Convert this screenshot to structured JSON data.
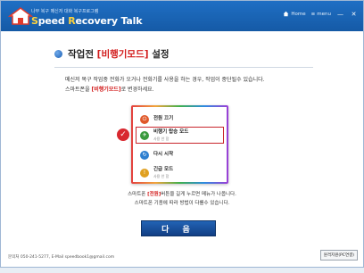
{
  "titlebar": {
    "subtitle": "나무 복구 메신저 대화 복구프로그램",
    "name_first": "S",
    "name_rest1": "peed ",
    "name_o": "R",
    "name_rest2": "ecovery Talk",
    "home_label": "Home",
    "menu_label": "menu",
    "minimize_glyph": "—",
    "close_glyph": "✕"
  },
  "heading": {
    "prefix": "작업전 ",
    "highlight": "[비행기모드]",
    "suffix": " 설정"
  },
  "description": {
    "line1": "메신저 복구 작업중 전화가 오거나 전화기를 사용을 하는 경우, 작업이 중단될수 있습니다.",
    "line2_prefix": "스마트폰을 ",
    "line2_highlight": "[비행기모드]",
    "line2_suffix": "로 변경하세요."
  },
  "phone_menu": [
    {
      "label": "전원 끄기",
      "sub": "",
      "icon": "power-icon",
      "color": "#e0582a",
      "selected": false
    },
    {
      "label": "비행기 탑승 모드",
      "sub": "사용 안 함",
      "icon": "airplane-icon",
      "color": "#3a9a3e",
      "selected": true
    },
    {
      "label": "다시 시작",
      "sub": "",
      "icon": "restart-icon",
      "color": "#2d7fd0",
      "selected": false
    },
    {
      "label": "긴급 모드",
      "sub": "사용 안 함",
      "icon": "emergency-icon",
      "color": "#e0a020",
      "selected": false
    }
  ],
  "info": {
    "line1_prefix": "스마트폰 ",
    "line1_highlight": "[전원]",
    "line1_suffix": "버튼을 길게 누르면 메뉴가 나옵니다.",
    "line2": "스마트폰 기종에 따라 방법이 다를수 있습니다."
  },
  "next_button": "다 음",
  "footer": "문의처 050-241-5277, E-Mail speedbook1@gmail.com",
  "remote_button": "원격지원(PC연결)"
}
